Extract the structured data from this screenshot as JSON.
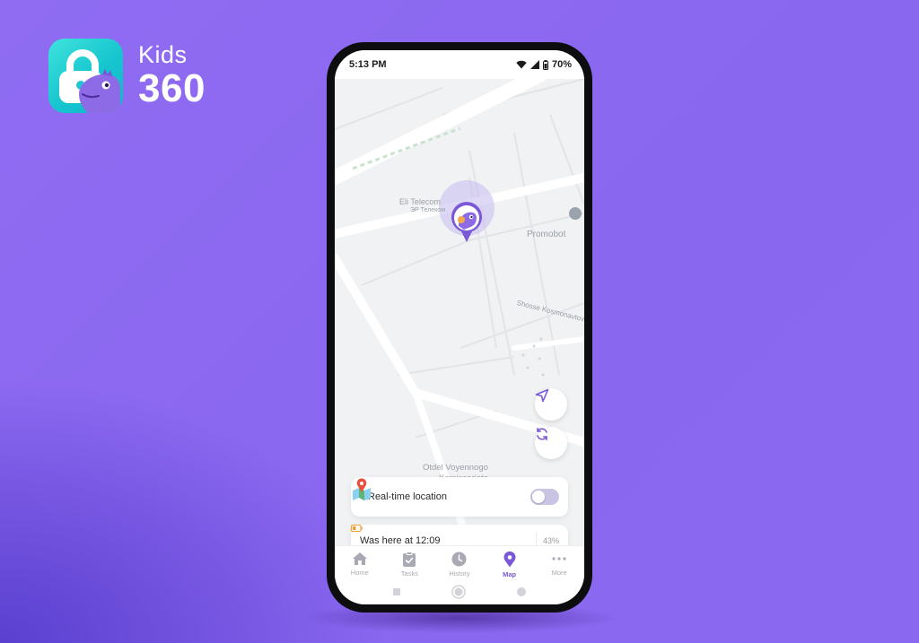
{
  "brand": {
    "name": "Kids",
    "number": "360"
  },
  "status": {
    "time": "5:13 PM",
    "battery": "70%"
  },
  "map": {
    "labels": {
      "eli_tele": "Eli Telecom",
      "eli_sub": "ЭР Телеком",
      "promobot": "Promobot",
      "shosse": "Shosse Kosmonavtov",
      "odel_line1": "Otdel Voyennogo",
      "odel_line2": "Komissariata"
    }
  },
  "realtime": {
    "title": "Real-time location",
    "enabled": false
  },
  "last_seen": {
    "text": "Was here at 12:09",
    "battery": "43%"
  },
  "tabs": [
    {
      "label": "Home",
      "icon": "home-icon"
    },
    {
      "label": "Tasks",
      "icon": "tasks-icon"
    },
    {
      "label": "History",
      "icon": "history-icon"
    },
    {
      "label": "Map",
      "icon": "map-pin-icon",
      "active": true
    },
    {
      "label": "More",
      "icon": "more-icon"
    }
  ],
  "colors": {
    "accent": "#7a58d6",
    "background": "#8b68f0",
    "brand_teal": "#16c5cf"
  }
}
